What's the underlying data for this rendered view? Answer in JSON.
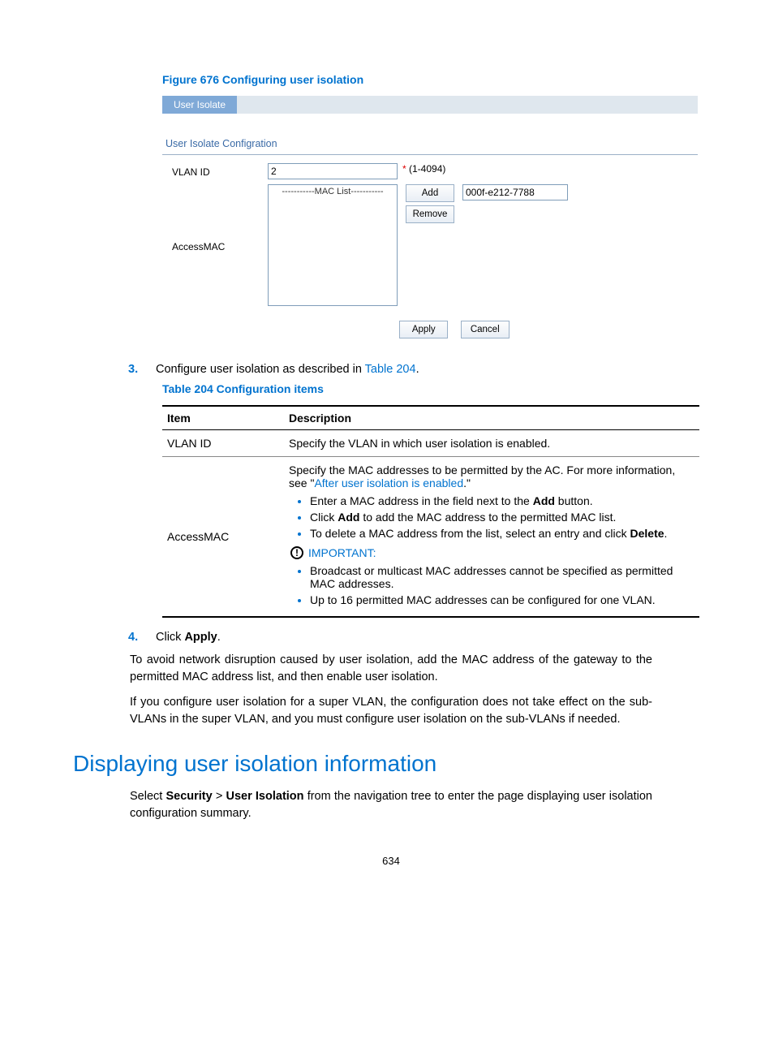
{
  "figure": {
    "caption": "Figure 676 Configuring user isolation",
    "tab_label": "User Isolate",
    "panel_title": "User Isolate Configration",
    "vlan_label": "VLAN ID",
    "vlan_value": "2",
    "vlan_hint": "(1-4094)",
    "accessmac_label": "AccessMAC",
    "maclist_header": "-----------MAC List-----------",
    "add_btn": "Add",
    "remove_btn": "Remove",
    "mac_value": "000f-e212-7788",
    "apply_btn": "Apply",
    "cancel_btn": "Cancel"
  },
  "steps": {
    "s3": {
      "num": "3.",
      "text_a": "Configure user isolation as described in ",
      "link": "Table 204",
      "text_b": "."
    },
    "s4": {
      "num": "4.",
      "text_a": "Click ",
      "bold": "Apply",
      "text_b": "."
    }
  },
  "table": {
    "caption": "Table 204 Configuration items",
    "header_item": "Item",
    "header_desc": "Description",
    "row1_item": "VLAN ID",
    "row1_desc": "Specify the VLAN in which user isolation is enabled.",
    "row2_item": "AccessMAC",
    "row2_intro_a": "Specify the MAC addresses to be permitted by the AC. For more information, see \"",
    "row2_intro_link": "After user isolation is enabled",
    "row2_intro_b": ".\"",
    "b1_a": "Enter a MAC address in the field next to the ",
    "b1_bold": "Add",
    "b1_b": " button.",
    "b2_a": "Click ",
    "b2_bold": "Add",
    "b2_b": " to add the MAC address to the permitted MAC list.",
    "b3_a": "To delete a MAC address from the list, select an entry and click ",
    "b3_bold": "Delete",
    "b3_b": ".",
    "important": "IMPORTANT:",
    "b4": "Broadcast or multicast MAC addresses cannot be specified as permitted MAC addresses.",
    "b5": "Up to 16 permitted MAC addresses can be configured for one VLAN."
  },
  "paras": {
    "p1": "To avoid network disruption caused by user isolation, add the MAC address of the gateway to the permitted MAC address list, and then enable user isolation.",
    "p2": "If you configure user isolation for a super VLAN, the configuration does not take effect on the sub-VLANs in the super VLAN, and you must configure user isolation on the sub-VLANs if needed."
  },
  "section": {
    "heading": "Displaying user isolation information",
    "body_a": "Select ",
    "body_b1": "Security",
    "body_c": " > ",
    "body_b2": "User Isolation",
    "body_d": " from the navigation tree to enter the page displaying user isolation configuration summary."
  },
  "page_num": "634"
}
